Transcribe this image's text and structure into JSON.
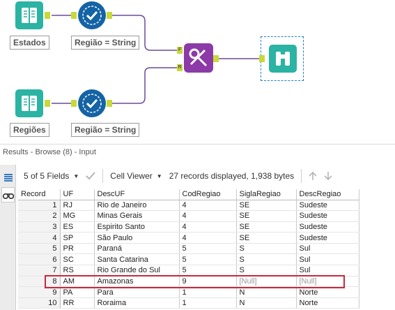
{
  "workflow": {
    "tools": {
      "estados_label": "Estados",
      "regiao1_label": "Região = String",
      "regioes_label": "Regiões",
      "regiao2_label": "Região = String"
    },
    "join_anchors": {
      "left": "F",
      "right": "R"
    },
    "colors": {
      "accent": "#1463a5",
      "book": "#2bb3a3",
      "join": "#8b3aa8",
      "anchor": "#c8d93a",
      "wire": "#6b4a9a"
    }
  },
  "results": {
    "header": "Results - Browse (8) - Input",
    "toolbar": {
      "fields_label": "5 of 5 Fields",
      "viewer_label": "Cell Viewer",
      "status": "27 records displayed, 1,938 bytes"
    },
    "columns": [
      "Record",
      "UF",
      "DescUF",
      "CodRegiao",
      "SiglaRegiao",
      "DescRegiao"
    ],
    "rows": [
      [
        "1",
        "RJ",
        "Rio de Janeiro",
        "4",
        "SE",
        "Sudeste"
      ],
      [
        "2",
        "MG",
        "Minas Gerais",
        "4",
        "SE",
        "Sudeste"
      ],
      [
        "3",
        "ES",
        "Espirito Santo",
        "4",
        "SE",
        "Sudeste"
      ],
      [
        "4",
        "SP",
        "São Paulo",
        "4",
        "SE",
        "Sudeste"
      ],
      [
        "5",
        "PR",
        "Paraná",
        "5",
        "S",
        "Sul"
      ],
      [
        "6",
        "SC",
        "Santa Catarina",
        "5",
        "S",
        "Sul"
      ],
      [
        "7",
        "RS",
        "Rio Grande do Sul",
        "5",
        "S",
        "Sul"
      ],
      [
        "8",
        "AM",
        "Amazonas",
        "9",
        "[Null]",
        "[Null]"
      ],
      [
        "9",
        "PA",
        "Para",
        "1",
        "N",
        "Norte"
      ],
      [
        "10",
        "RR",
        "Roraima",
        "1",
        "N",
        "Norte"
      ]
    ],
    "highlighted_record": "8"
  }
}
